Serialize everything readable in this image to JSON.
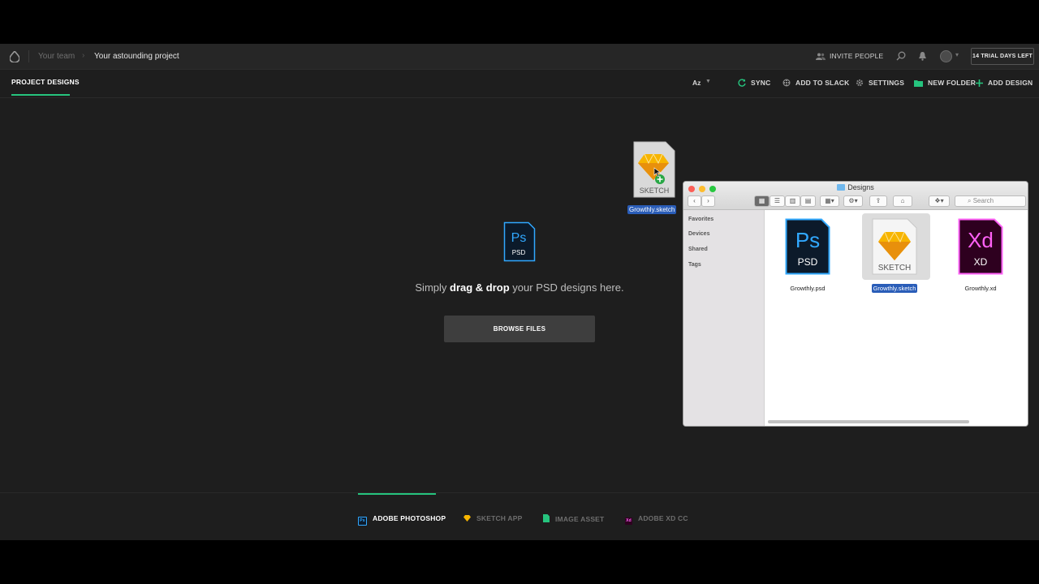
{
  "breadcrumb": {
    "team": "Your team",
    "project": "Your astounding project"
  },
  "topbar": {
    "invite_label": "INVITE PEOPLE",
    "trial_label": "14 TRIAL DAYS LEFT"
  },
  "toolbar": {
    "tab_label": "PROJECT DESIGNS",
    "sort_label": "Az",
    "sync_label": "SYNC",
    "slack_label": "ADD TO SLACK",
    "settings_label": "SETTINGS",
    "new_folder_label": "NEW FOLDER",
    "add_design_label": "ADD DESIGN"
  },
  "dropzone": {
    "icon_top": "Ps",
    "icon_bottom": "PSD",
    "text_before": "Simply ",
    "text_bold": "drag & drop",
    "text_after": " your PSD designs here.",
    "browse_label": "BROWSE FILES"
  },
  "bottom_tabs": [
    {
      "label": "ADOBE PHOTOSHOP",
      "badge": "Ps",
      "active": true
    },
    {
      "label": "SKETCH APP",
      "badge": "",
      "active": false
    },
    {
      "label": "IMAGE ASSET",
      "badge": "",
      "active": false
    },
    {
      "label": "ADOBE XD CC",
      "badge": "Xd",
      "active": false
    }
  ],
  "dragged_file": {
    "name": "Growthly.sketch",
    "icon_label": "SKETCH"
  },
  "finder": {
    "title": "Designs",
    "search_placeholder": "Search",
    "sidebar": [
      "Favorites",
      "Devices",
      "Shared",
      "Tags"
    ],
    "files": [
      {
        "name": "Growthly.psd",
        "icon_top": "Ps",
        "icon_bottom": "PSD",
        "selected": false
      },
      {
        "name": "Growthly.sketch",
        "icon_bottom": "SKETCH",
        "selected": true
      },
      {
        "name": "Growthly.xd",
        "icon_top": "Xd",
        "icon_bottom": "XD",
        "selected": false
      }
    ]
  },
  "colors": {
    "accent": "#26c47e",
    "ps_blue": "#31a8ff",
    "xd_pink": "#ff61f6",
    "sketch_gold": "#f7b500"
  }
}
